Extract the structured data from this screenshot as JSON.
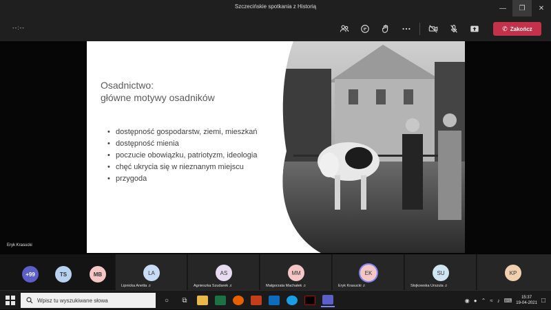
{
  "window": {
    "title": "Szczecińskie spotkania z Historią"
  },
  "toolbar": {
    "timer": "--:--",
    "end_label": "Zakończ"
  },
  "slide": {
    "title": "Osadnictwo:\ngłówne motywy osadników",
    "bullets": [
      "dostępność gospodarstw, ziemi, mieszkań",
      "dostępność mienia",
      "poczucie obowiązku, patriotyzm, ideologia",
      "chęć ukrycia się w nieznanym miejscu",
      "przygoda"
    ]
  },
  "speaker": {
    "name": "Eryk Krasucki"
  },
  "participants": {
    "compact": [
      {
        "initials": "+99",
        "color": "#5b5fc7"
      },
      {
        "initials": "TS",
        "color": "#b7d2ef"
      },
      {
        "initials": "MB",
        "color": "#f4c6c6"
      }
    ],
    "tiles": [
      {
        "initials": "LA",
        "name": "Lipnicka Anetta",
        "color": "#c9dcf5"
      },
      {
        "initials": "AS",
        "name": "Agnieszka Szudarek",
        "color": "#e8dcf2"
      },
      {
        "initials": "MM",
        "name": "Małgorzata Machałek",
        "color": "#f4c6c6"
      },
      {
        "initials": "EK",
        "name": "Eryk Krasucki",
        "color": "#f4c6c6"
      },
      {
        "initials": "SU",
        "name": "Słojkowska Urszula",
        "color": "#cfe5f0"
      },
      {
        "initials": "KP",
        "name": "",
        "color": "#f1d0b0"
      }
    ]
  },
  "taskbar": {
    "search_placeholder": "Wpisz tu wyszukiwane słowa",
    "time": "15:37",
    "date": "19-04-2021"
  }
}
